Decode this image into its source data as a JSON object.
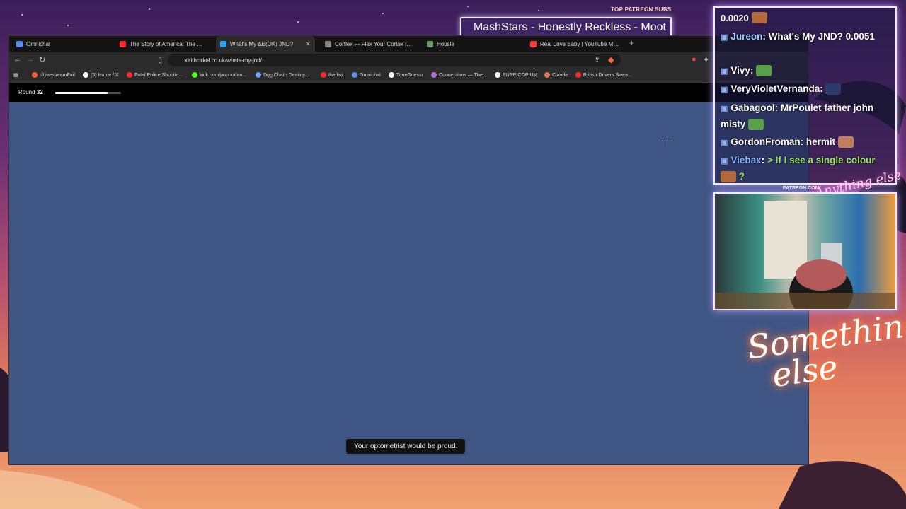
{
  "overlay": {
    "top_patreon_label": "TOP PATREON SUBS",
    "top_patreon_names": "MashStars - Honestly Reckless - Moot",
    "patreon_url": "PATREON.COM/",
    "brand_small": "Anything else",
    "brand_large": "Something else"
  },
  "chat": {
    "top_value": "0.0020",
    "messages": [
      {
        "user": "Jureon",
        "text": "What's My JND? 0.0051",
        "user_color": "#9fd0ff"
      },
      {
        "user": "Vivy",
        "text": "",
        "user_color": "#ffffff"
      },
      {
        "user": "VeryVioletVernanda",
        "text": "",
        "user_color": "#ffffff"
      },
      {
        "user": "Gabagool",
        "text": "MrPoulet father john misty",
        "user_color": "#ffffff"
      },
      {
        "user": "GordonFroman",
        "text": "hermit",
        "user_color": "#ffffff"
      },
      {
        "user": "Viebax",
        "text": "> If I see a single colour",
        "user_color": "#7fb3ff",
        "text_color": "#9be36d"
      }
    ],
    "trailing": "?"
  },
  "browser": {
    "tabs": [
      {
        "label": "Omnichat",
        "icon_color": "#5b8def"
      },
      {
        "label": "The Story of America: The King's Call",
        "icon_color": "#ff2b2b"
      },
      {
        "label": "What's My ΔE(OK) JND?",
        "icon_color": "#2ea3f2",
        "active": true
      },
      {
        "label": "Corflex — Flex Your Cortex | Free Bra",
        "icon_color": "#888888"
      },
      {
        "label": "Housle",
        "icon_color": "#6aa36a"
      },
      {
        "label": "Real Love Baby | YouTube Music",
        "icon_color": "#ff3b3b"
      }
    ],
    "new_tab": "+",
    "url": "keithcirkel.co.uk/whats-my-jnd/",
    "bookmarks": [
      {
        "label": "r/LivestreamFail",
        "icon_color": "#ff5a36"
      },
      {
        "label": "(5) Home / X",
        "icon_color": "#ffffff"
      },
      {
        "label": "Fatal Police Shootin...",
        "icon_color": "#ff2b2b"
      },
      {
        "label": "kick.com/popout/an...",
        "icon_color": "#53fc18"
      },
      {
        "label": "Dgg Chat - Destiny...",
        "icon_color": "#6aa0ff"
      },
      {
        "label": "the list",
        "icon_color": "#ff2b2b"
      },
      {
        "label": "Omnichat",
        "icon_color": "#5b8def"
      },
      {
        "label": "TimeGuessr",
        "icon_color": "#ffffff"
      },
      {
        "label": "Connections — The...",
        "icon_color": "#b06ad9"
      },
      {
        "label": "PURE COPIUM",
        "icon_color": "#ffffff"
      },
      {
        "label": "Claude",
        "icon_color": "#d97757"
      },
      {
        "label": "British Drivers Swea...",
        "icon_color": "#ff2b2b"
      }
    ],
    "page": {
      "round_label": "Round",
      "round_number": "32",
      "progress_fraction": 0.8,
      "background_color": "#3f5584",
      "toast": "Your optometrist would be proud."
    }
  }
}
